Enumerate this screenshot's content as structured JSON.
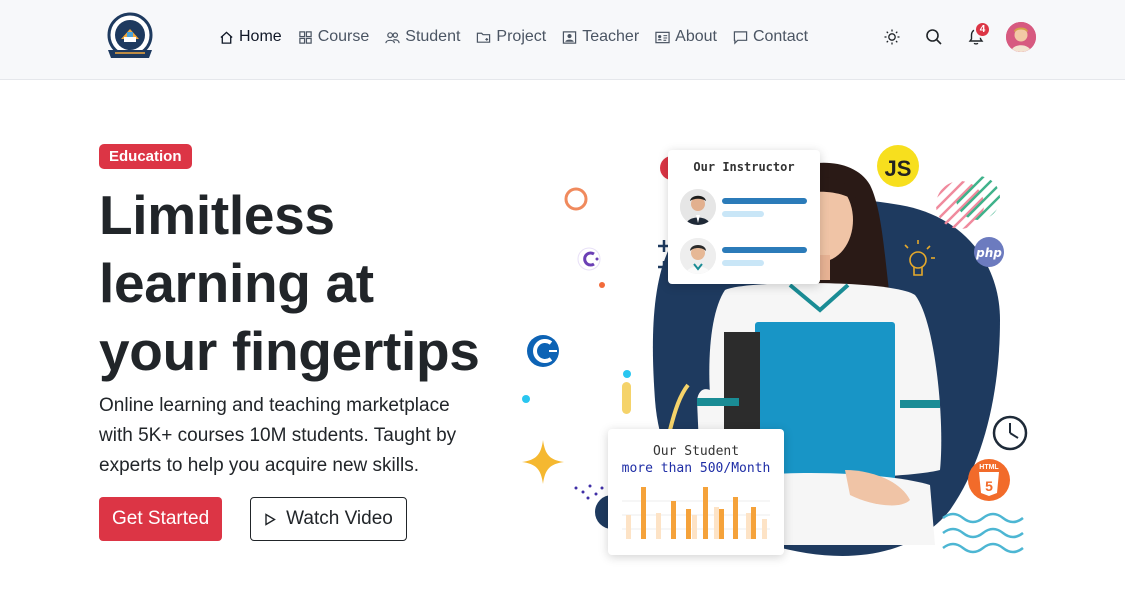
{
  "brand": {
    "logo_icon": "school-crest-icon",
    "accent_color": "#dc3545",
    "navy_color": "#1e3a5f"
  },
  "nav": {
    "items": [
      {
        "label": "Home",
        "icon": "home-icon",
        "active": true
      },
      {
        "label": "Course",
        "icon": "grid-icon",
        "active": false
      },
      {
        "label": "Student",
        "icon": "users-icon",
        "active": false
      },
      {
        "label": "Project",
        "icon": "folder-icon",
        "active": false
      },
      {
        "label": "Teacher",
        "icon": "person-badge-icon",
        "active": false
      },
      {
        "label": "About",
        "icon": "id-card-icon",
        "active": false
      },
      {
        "label": "Contact",
        "icon": "chat-icon",
        "active": false
      }
    ]
  },
  "tools": {
    "theme_icon": "sun-icon",
    "search_icon": "search-icon",
    "bell_icon": "bell-icon",
    "notification_count": "4",
    "avatar": "user-avatar"
  },
  "hero": {
    "tag": "Education",
    "title_line1": "Limitless",
    "title_line2": "learning at",
    "title_line3": "your fingertips",
    "lead": "Online learning and teaching marketplace with 5K+ courses 10M students. Taught by experts to help you acquire new skills.",
    "primary_button": "Get Started",
    "secondary_button": "Watch Video"
  },
  "instructor_card": {
    "title": "Our Instructor"
  },
  "student_card": {
    "line1": "Our Student",
    "line2": "more than 500/Month"
  },
  "decor": {
    "js_badge": "JS",
    "php_badge": "php",
    "html_badge": "HTML",
    "html_number": "5"
  }
}
